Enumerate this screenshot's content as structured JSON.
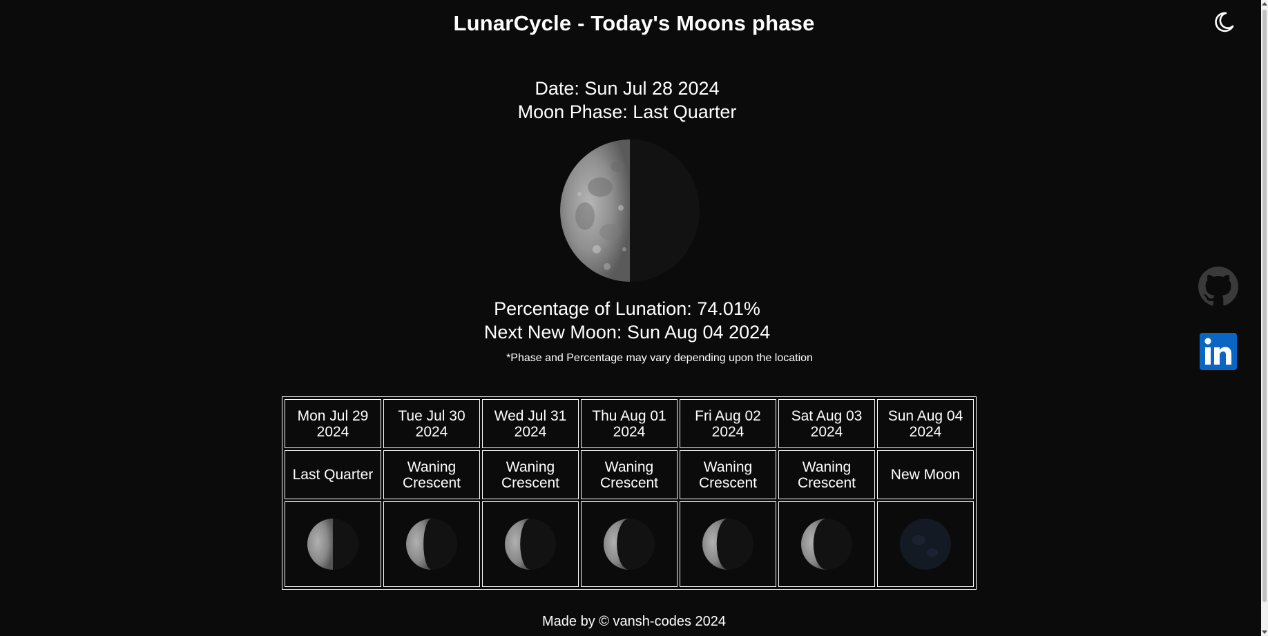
{
  "header": {
    "title": "LunarCycle - Today's Moons phase",
    "theme_toggle_icon": "crescent-moon-icon"
  },
  "today": {
    "date_line": "Date: Sun Jul 28 2024",
    "phase_line": "Moon Phase: Last Quarter",
    "lunation_line": "Percentage of Lunation: 74.01%",
    "next_new_moon_line": "Next New Moon: Sun Aug 04 2024",
    "note": "*Phase and Percentage may vary depending upon the location",
    "lunation_percent": 74.01
  },
  "forecast": [
    {
      "date": "Mon Jul 29 2024",
      "phase": "Last Quarter",
      "lit_fraction": 0.5
    },
    {
      "date": "Tue Jul 30 2024",
      "phase": "Waning Crescent",
      "lit_fraction": 0.34
    },
    {
      "date": "Wed Jul 31 2024",
      "phase": "Waning Crescent",
      "lit_fraction": 0.3
    },
    {
      "date": "Thu Aug 01 2024",
      "phase": "Waning Crescent",
      "lit_fraction": 0.26
    },
    {
      "date": "Fri Aug 02 2024",
      "phase": "Waning Crescent",
      "lit_fraction": 0.28
    },
    {
      "date": "Sat Aug 03 2024",
      "phase": "Waning Crescent",
      "lit_fraction": 0.24
    },
    {
      "date": "Sun Aug 04 2024",
      "phase": "New Moon",
      "lit_fraction": 0.0
    }
  ],
  "social": {
    "github_icon": "github-icon",
    "linkedin_icon": "linkedin-icon",
    "linkedin_color": "#0a66c2",
    "github_color": "#3a3a3a"
  },
  "footer": {
    "text": "Made by © vansh-codes 2024"
  },
  "colors": {
    "background": "#0b0b0b",
    "text": "#ffffff"
  }
}
